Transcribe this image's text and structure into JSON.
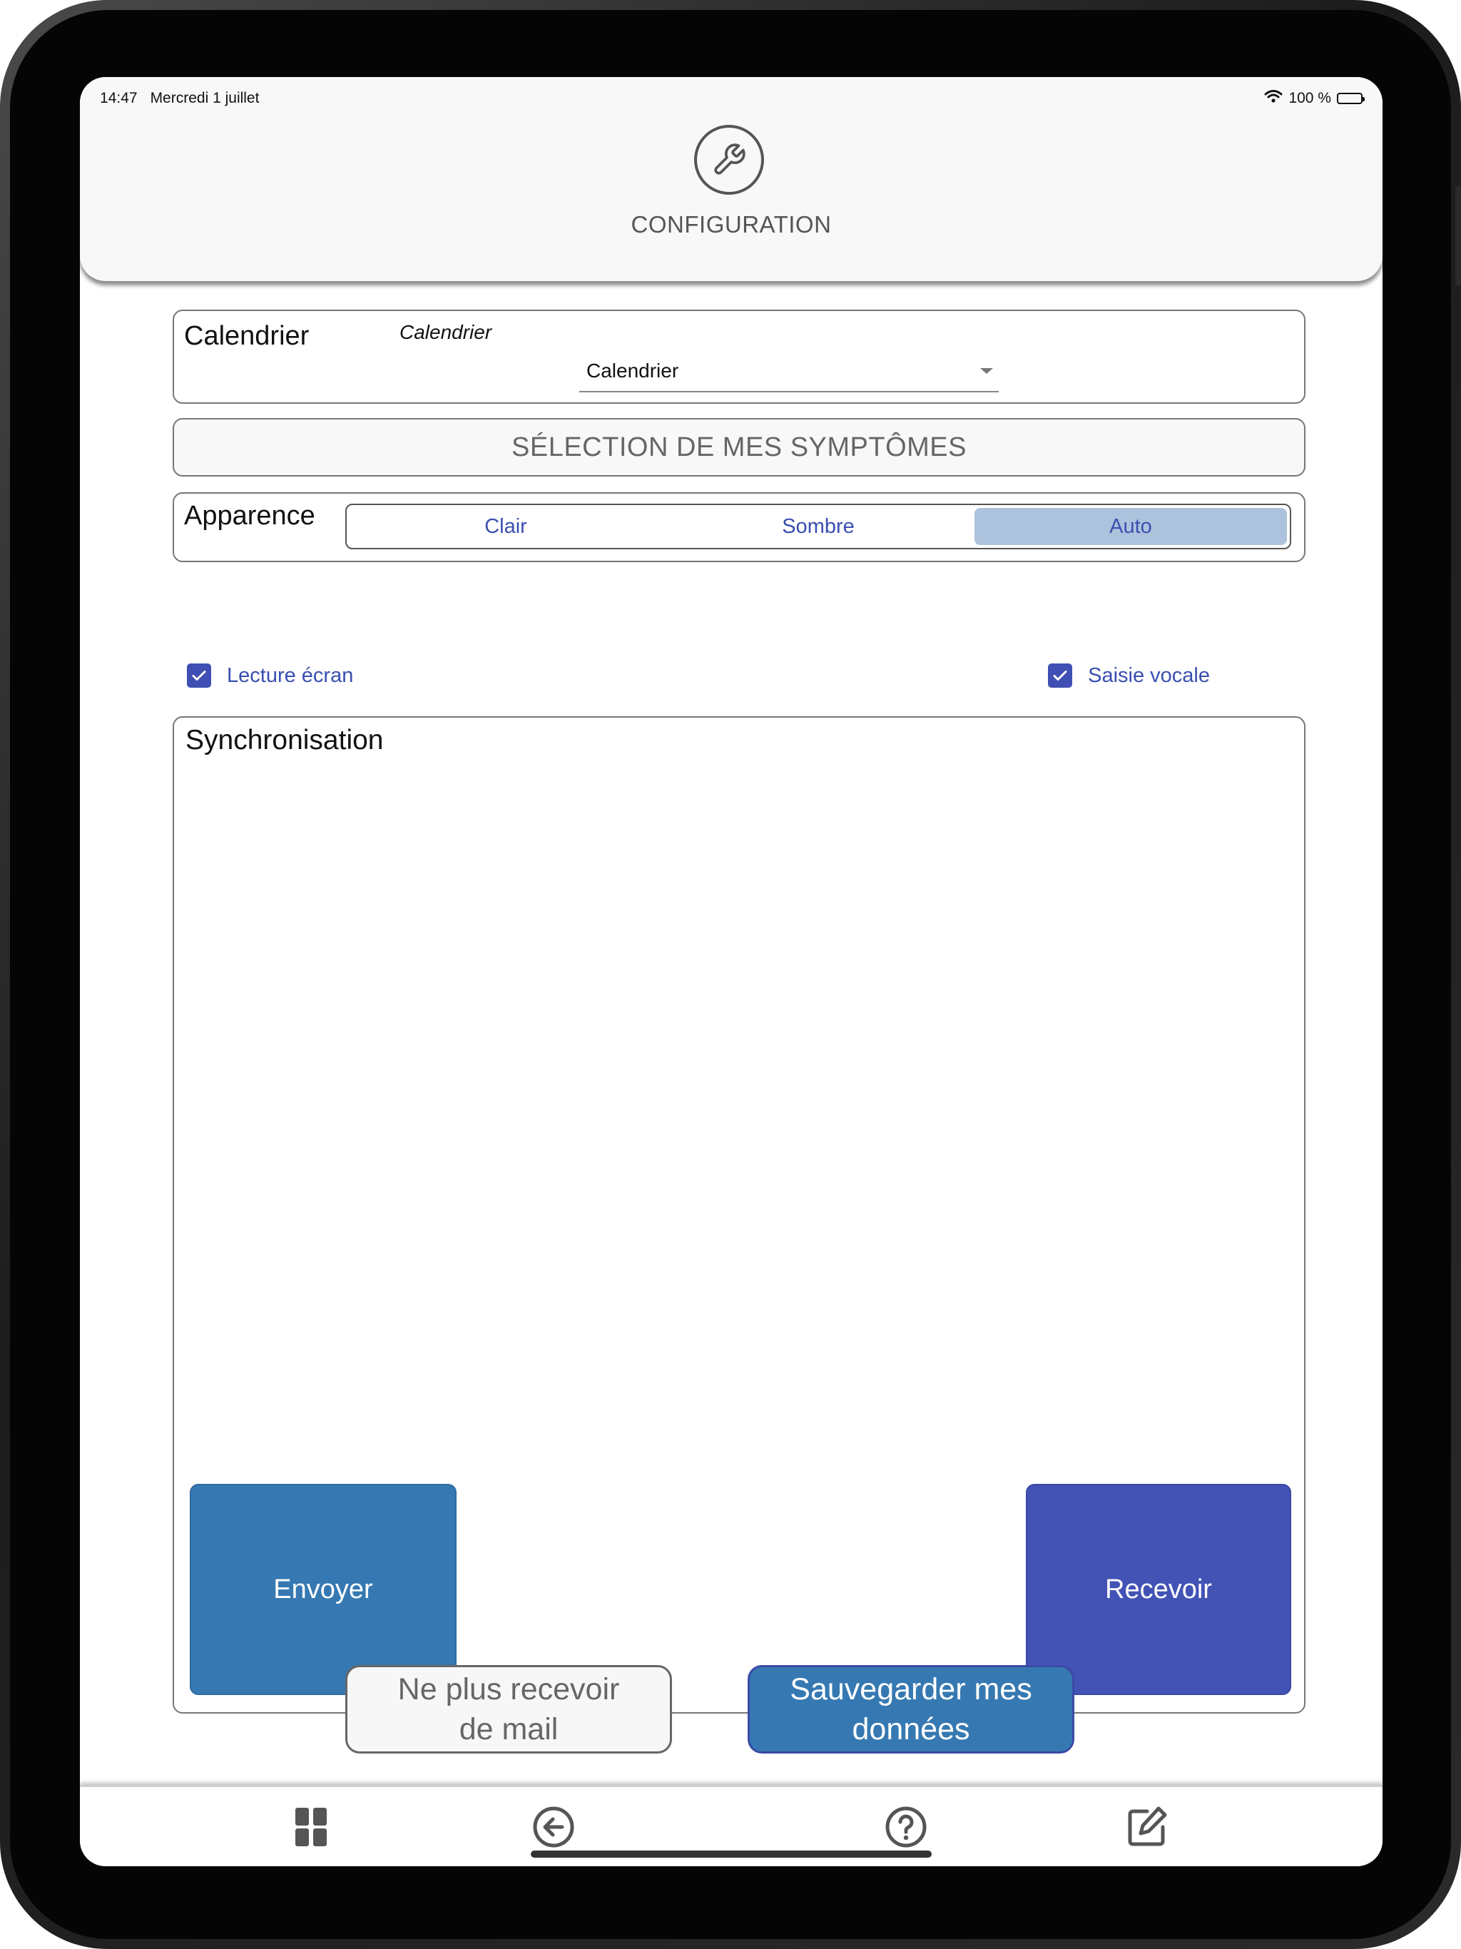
{
  "status_bar": {
    "time": "14:47",
    "date": "Mercredi 1 juillet",
    "battery": "100 %"
  },
  "header": {
    "icon": "wrench-icon",
    "title": "CONFIGURATION"
  },
  "calendar": {
    "label": "Calendrier",
    "select_caption": "Calendrier",
    "select_value": "Calendrier"
  },
  "symptoms_button": "SÉLECTION DE MES SYMPTÔMES",
  "appearance": {
    "label": "Apparence",
    "options": [
      "Clair",
      "Sombre",
      "Auto"
    ],
    "selected": "Auto"
  },
  "options": {
    "screen_reader": {
      "label": "Lecture écran",
      "checked": true
    },
    "voice_input": {
      "label": "Saisie vocale",
      "checked": true
    }
  },
  "sync": {
    "title": "Synchronisation",
    "send_label": "Envoyer",
    "receive_label": "Recevoir"
  },
  "footer": {
    "unsubscribe_line1": "Ne plus recevoir",
    "unsubscribe_line2": "de mail",
    "save_line1": "Sauvegarder mes",
    "save_line2": "données"
  },
  "nav": {
    "icons": [
      "grid-icon",
      "back-arrow-icon",
      "help-icon",
      "edit-icon"
    ]
  },
  "colors": {
    "accent_blue": "#3679b2",
    "accent_indigo": "#4253b5",
    "link_blue": "#3a4fb0",
    "selected_segment": "#adc3dd"
  }
}
